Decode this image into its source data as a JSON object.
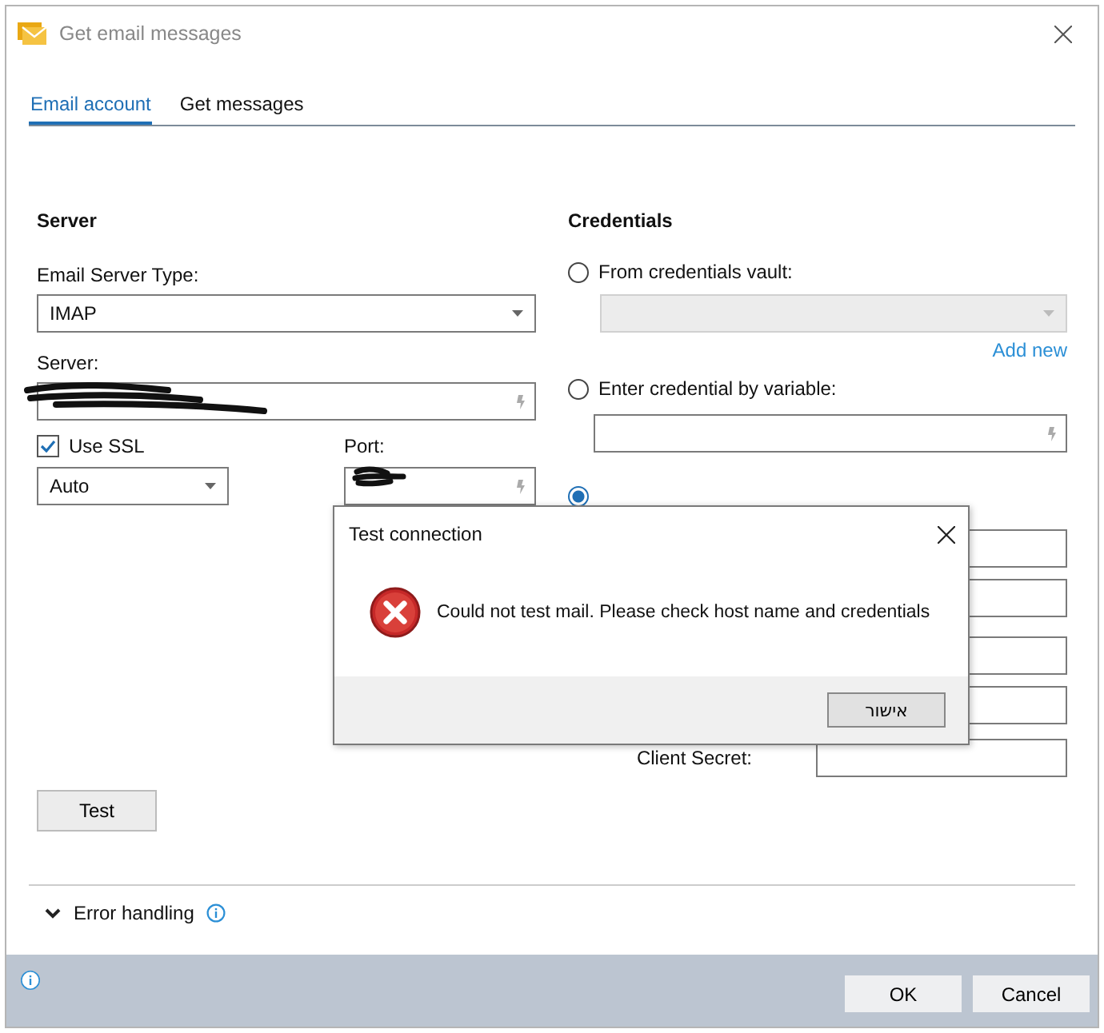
{
  "window": {
    "title": "Get email messages"
  },
  "tabs": [
    {
      "label": "Email account",
      "selected": true
    },
    {
      "label": "Get messages",
      "selected": false
    }
  ],
  "server": {
    "heading": "Server",
    "type_label": "Email Server Type:",
    "type_value": "IMAP",
    "server_label": "Server:",
    "ssl": {
      "label": "Use SSL",
      "checked": true
    },
    "ssl_mode": "Auto",
    "port_label": "Port:",
    "test_button": "Test"
  },
  "credentials": {
    "heading": "Credentials",
    "options": [
      {
        "label": "From credentials vault:",
        "selected": false
      },
      {
        "label": "Enter credential by variable:",
        "selected": false
      },
      {
        "selected": true
      }
    ],
    "add_new": "Add new",
    "manual_fields": [
      {
        "kind": "input"
      },
      {
        "kind": "input"
      },
      {
        "kind": "input"
      },
      {
        "kind": "input"
      },
      {
        "kind": "input",
        "label": "Client Secret:"
      }
    ]
  },
  "error_handling": {
    "label": "Error handling",
    "expanded": true
  },
  "buttons": [
    "OK",
    "Cancel"
  ],
  "message_box": {
    "title": "Test connection",
    "message": "Could not test mail. Please check host name and credentials",
    "button": "אישור"
  }
}
